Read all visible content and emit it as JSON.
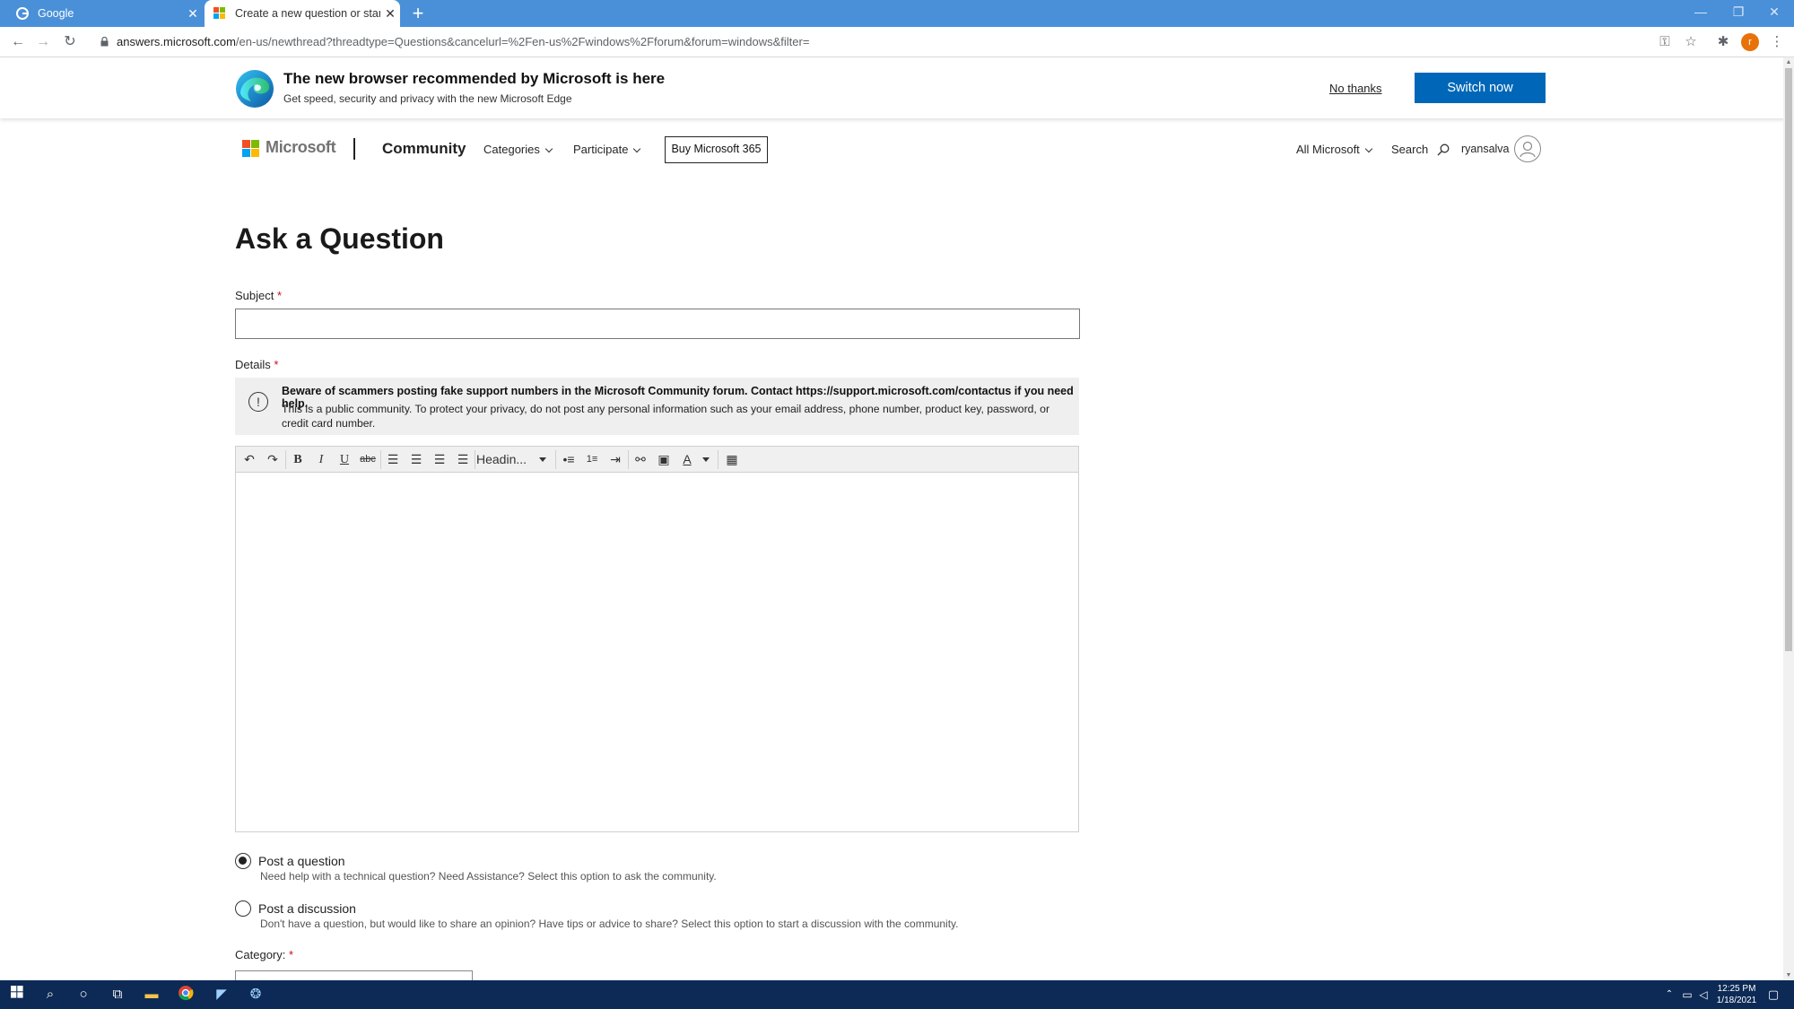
{
  "browser": {
    "tabs": [
      {
        "title": "Google",
        "active": false
      },
      {
        "title": "Create a new question or start a",
        "active": true
      }
    ],
    "url_host": "answers.microsoft.com",
    "url_path": "/en-us/newthread?threadtype=Questions&cancelurl=%2Fen-us%2Fwindows%2Fforum&forum=windows&filter=",
    "profile_initial": "r"
  },
  "banner": {
    "title": "The new browser recommended by Microsoft is here",
    "subtitle": "Get speed, security and privacy with the new Microsoft Edge",
    "no_thanks": "No thanks",
    "switch_now": "Switch now"
  },
  "header": {
    "brand": "Microsoft",
    "section": "Community",
    "nav": [
      "Categories",
      "Participate"
    ],
    "buy": "Buy Microsoft 365",
    "all_microsoft": "All Microsoft",
    "search": "Search",
    "username": "ryansalva"
  },
  "form": {
    "title": "Ask a Question",
    "subject_label": "Subject",
    "details_label": "Details",
    "required_mark": "*",
    "warning_bold": "Beware of scammers posting fake support numbers in the Microsoft Community forum. Contact https://support.microsoft.com/contactus if you need help.",
    "warning_text": "This is a public community. To protect your privacy, do not post any personal information such as your email address, phone number, product key, password, or credit card number.",
    "heading_dropdown": "Headin...",
    "options": [
      {
        "label": "Post a question",
        "desc": "Need help with a technical question? Need Assistance? Select this option to ask the community.",
        "checked": true
      },
      {
        "label": "Post a discussion",
        "desc": "Don't have a question, but would like to share an opinion? Have tips or advice to share? Select this option to start a discussion with the community.",
        "checked": false
      }
    ],
    "category_label": "Category:"
  },
  "taskbar": {
    "time": "12:25 PM",
    "date": "1/18/2021"
  },
  "colors": {
    "tabbar": "#4a90d9",
    "primary": "#0067b8",
    "taskbar": "#0c2a55"
  }
}
